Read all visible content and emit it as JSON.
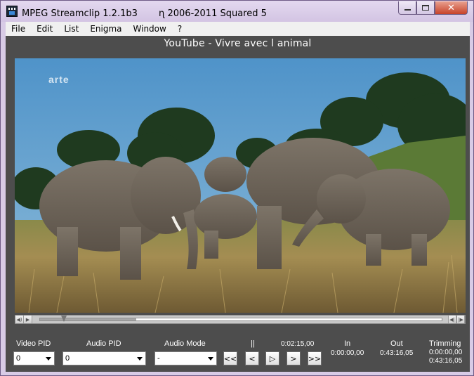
{
  "window": {
    "title": "MPEG Streamclip 1.2.1b3 　　ɳ 2006-2011 Squared 5",
    "minimize_glyph": "–",
    "maximize_glyph": "□",
    "close_glyph": "✕"
  },
  "menu": [
    "File",
    "Edit",
    "List",
    "Enigma",
    "Window",
    "?"
  ],
  "movie": {
    "title": "YouTube -  Vivre avec l animal",
    "watermark": "arte"
  },
  "scrubber": {
    "position": 0.06,
    "loaded": 0.24
  },
  "controls": {
    "video_pid": {
      "label": "Video PID",
      "value": "0"
    },
    "audio_pid": {
      "label": "Audio PID",
      "value": "0"
    },
    "audio_mode": {
      "label": "Audio Mode",
      "value": "-"
    },
    "pause_indicator": "||",
    "current_time": "0:02:15,00",
    "in": {
      "label": "In",
      "value": "0:00:00,00"
    },
    "out": {
      "label": "Out",
      "value": "0:43:16,05"
    },
    "trimming": {
      "label": "Trimming",
      "start": "0:00:00,00",
      "end": "0:43:16,05"
    },
    "buttons": {
      "rewind": "<<",
      "step_back": "<",
      "play": "▷",
      "step_forward": ">",
      "fast_forward": ">>"
    }
  },
  "colors": {
    "client_bg": "#4d4d4d",
    "frame": "#d8cbe6",
    "sky": "#5f9fd0",
    "grass": "#9c8a4c"
  }
}
